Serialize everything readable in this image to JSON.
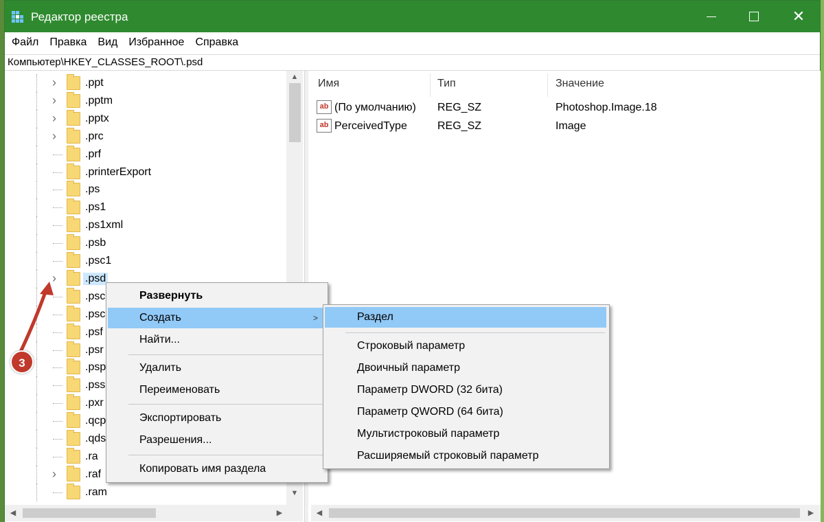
{
  "window": {
    "title": "Редактор реестра"
  },
  "menubar": [
    "Файл",
    "Правка",
    "Вид",
    "Избранное",
    "Справка"
  ],
  "address": "Компьютер\\HKEY_CLASSES_ROOT\\.psd",
  "tree": {
    "items": [
      {
        "label": ".ppt",
        "expandable": true
      },
      {
        "label": ".pptm",
        "expandable": true
      },
      {
        "label": ".pptx",
        "expandable": true
      },
      {
        "label": ".prc",
        "expandable": true
      },
      {
        "label": ".prf",
        "expandable": false
      },
      {
        "label": ".printerExport",
        "expandable": false
      },
      {
        "label": ".ps",
        "expandable": false
      },
      {
        "label": ".ps1",
        "expandable": false
      },
      {
        "label": ".ps1xml",
        "expandable": false
      },
      {
        "label": ".psb",
        "expandable": false
      },
      {
        "label": ".psc1",
        "expandable": false
      },
      {
        "label": ".psd",
        "expandable": true,
        "selected": true
      },
      {
        "label": ".psc",
        "expandable": false
      },
      {
        "label": ".psc",
        "expandable": false
      },
      {
        "label": ".psf",
        "expandable": false
      },
      {
        "label": ".psr",
        "expandable": false
      },
      {
        "label": ".psp",
        "expandable": false
      },
      {
        "label": ".pss",
        "expandable": false
      },
      {
        "label": ".pxr",
        "expandable": false
      },
      {
        "label": ".qcp",
        "expandable": false
      },
      {
        "label": ".qds",
        "expandable": false
      },
      {
        "label": ".ra",
        "expandable": false
      },
      {
        "label": ".raf",
        "expandable": true
      },
      {
        "label": ".ram",
        "expandable": false
      }
    ]
  },
  "values_list": {
    "columns": [
      "Имя",
      "Тип",
      "Значение"
    ],
    "rows": [
      {
        "name": "(По умолчанию)",
        "type": "REG_SZ",
        "data": "Photoshop.Image.18"
      },
      {
        "name": "PerceivedType",
        "type": "REG_SZ",
        "data": "Image"
      }
    ]
  },
  "context_menu": {
    "items": [
      {
        "label": "Развернуть",
        "bold": true
      },
      {
        "label": "Создать",
        "submenu": true,
        "highlighted": true
      },
      {
        "label": "Найти..."
      },
      {
        "label": "Удалить"
      },
      {
        "label": "Переименовать"
      },
      {
        "label": "Экспортировать"
      },
      {
        "label": "Разрешения..."
      },
      {
        "label": "Копировать имя раздела"
      }
    ]
  },
  "submenu": {
    "items": [
      {
        "label": "Раздел",
        "highlighted": true
      },
      {
        "label": "Строковый параметр"
      },
      {
        "label": "Двоичный параметр"
      },
      {
        "label": "Параметр DWORD (32 бита)"
      },
      {
        "label": "Параметр QWORD (64 бита)"
      },
      {
        "label": "Мультистроковый параметр"
      },
      {
        "label": "Расширяемый строковый параметр"
      }
    ]
  },
  "annotation": {
    "badge": "3"
  },
  "colors": {
    "titlebar": "#2f8a2f",
    "highlight": "#91c9f7",
    "annotation": "#c0392b"
  }
}
